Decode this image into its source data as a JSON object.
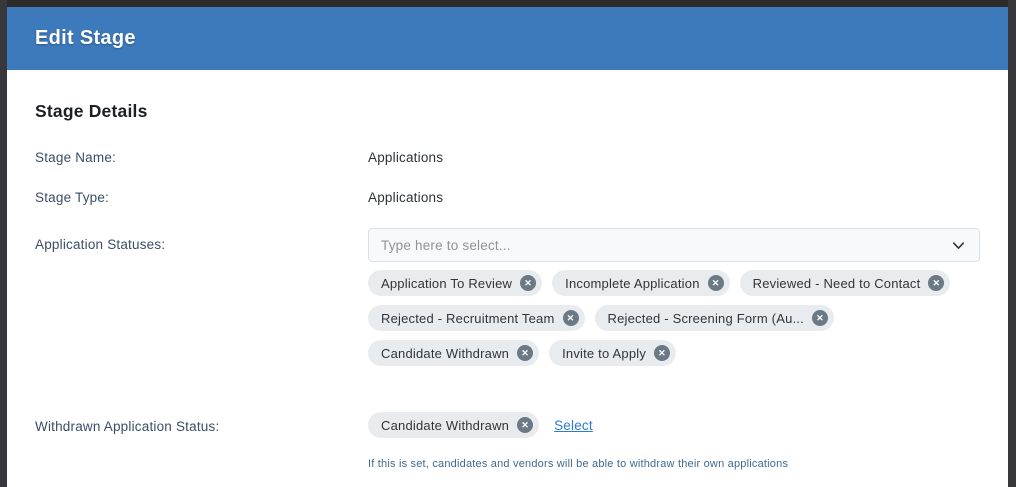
{
  "modal": {
    "title": "Edit Stage",
    "section_title": "Stage Details"
  },
  "fields": {
    "stage_name": {
      "label": "Stage Name:",
      "value": "Applications"
    },
    "stage_type": {
      "label": "Stage Type:",
      "value": "Applications"
    },
    "application_statuses": {
      "label": "Application Statuses:",
      "placeholder": "Type here to select...",
      "chips": [
        "Application To Review",
        "Incomplete Application",
        "Reviewed - Need to Contact",
        "Rejected - Recruitment Team",
        "Rejected - Screening Form (Au...",
        "Candidate Withdrawn",
        "Invite to Apply"
      ]
    },
    "withdrawn_status": {
      "label": "Withdrawn Application Status:",
      "chips": [
        "Candidate Withdrawn"
      ],
      "select_link": "Select",
      "helper": "If this is set, candidates and vendors will be able to withdraw their own applications"
    }
  },
  "icons": {
    "remove": "✕",
    "chevron_down": "chevron-down-icon"
  },
  "colors": {
    "header_blue": "#3d7abc",
    "chip_bg": "#e9ecef",
    "chip_remove_bg": "#6b7987",
    "link_blue": "#2c7ad3",
    "helper_blue": "#3c6b91",
    "label_slate": "#3b4e66"
  }
}
